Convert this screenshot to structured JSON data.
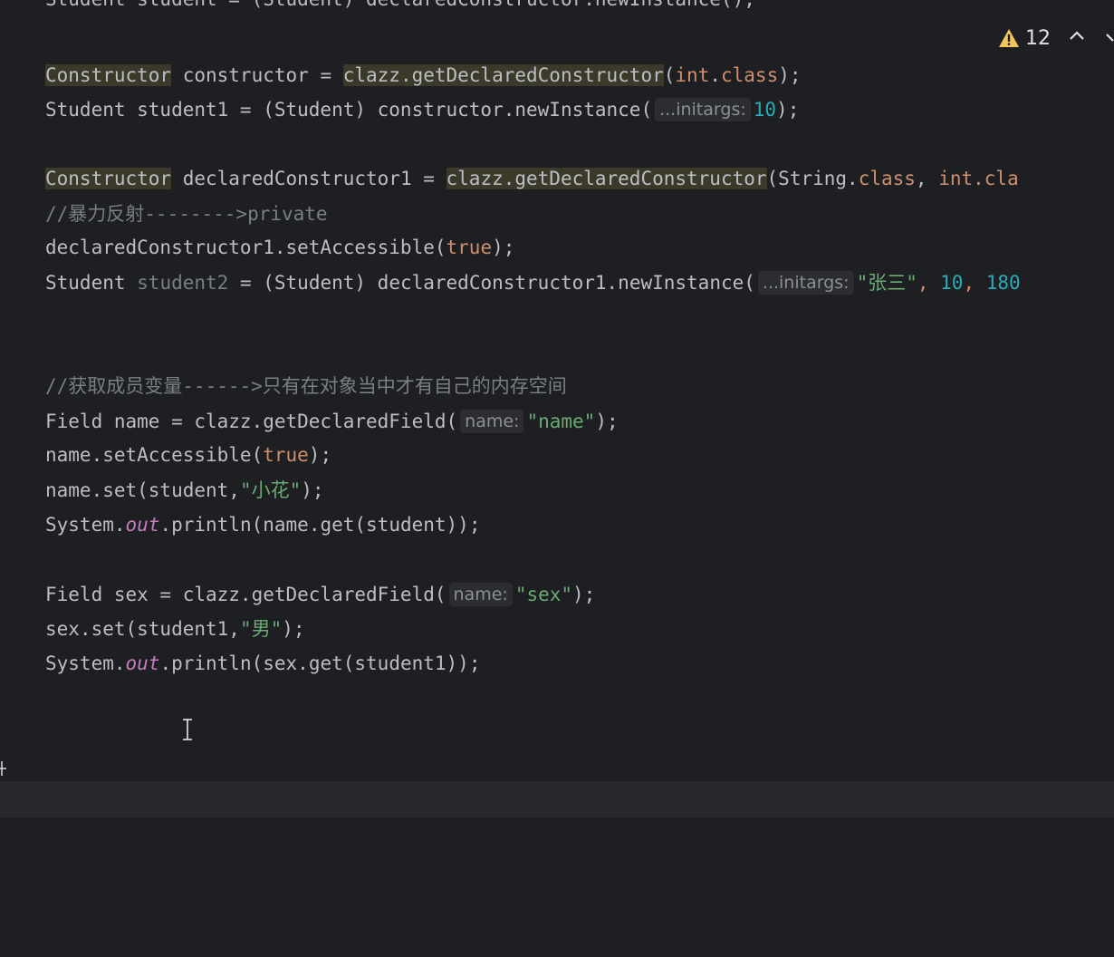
{
  "inspection": {
    "warning_count": "12",
    "warning_icon": "warning-triangle-icon",
    "up_icon": "chevron-up-icon",
    "down_icon": "chevron-down-icon"
  },
  "code": {
    "line0": "Student student = (Student) declaredConstructor.newInstance();",
    "line1": {
      "a": "Constructor",
      "b": " constructor = ",
      "c": "clazz.getDeclaredConstructor",
      "d": "(",
      "e": "int",
      "f": ".",
      "g": "class",
      "h": ");"
    },
    "line2": {
      "a": "Student student1 = (Student) constructor.newInstance(",
      "hint": "...initargs:",
      "b": "10",
      "c": ");"
    },
    "line3": {
      "a": "Constructor",
      "b": " declaredConstructor1 = ",
      "c": "clazz.getDeclaredConstructor",
      "d": "(String.",
      "e": "class",
      "f": ", ",
      "g": "int",
      "h": ".cla"
    },
    "line4": "//暴力反射-------->private",
    "line5": {
      "a": "declaredConstructor1.setAccessible(",
      "b": "true",
      "c": ");"
    },
    "line6": {
      "a": "Student ",
      "b": "student2",
      "c": " = (Student) declaredConstructor1.newInstance(",
      "hint": "...initargs:",
      "d": "\"张三\"",
      "e": ", ",
      "f": "10",
      "g": ", ",
      "h": "180"
    },
    "line7": "//获取成员变量------>只有在对象当中才有自己的内存空间",
    "line8": {
      "a": "Field name = clazz.getDeclaredField(",
      "hint": "name:",
      "b": "\"name\"",
      "c": ");"
    },
    "line9": {
      "a": "name.setAccessible(",
      "b": "true",
      "c": ");"
    },
    "line10": {
      "a": "name.set(student,",
      "b": "\"小花\"",
      "c": ");"
    },
    "line11": {
      "a": "System.",
      "b": "out",
      "c": ".println(name.get(student));"
    },
    "line12": {
      "a": "Field sex = clazz.getDeclaredField(",
      "hint": "name:",
      "b": "\"sex\"",
      "c": ");"
    },
    "line13": {
      "a": "sex.set(student1,",
      "b": "\"男\"",
      "c": ");"
    },
    "line14": {
      "a": "System.",
      "b": "out",
      "c": ".println(sex.get(student1));"
    }
  },
  "colors": {
    "background": "#1e1f22",
    "text": "#bcbec4",
    "keyword": "#cf8e6d",
    "string": "#6aab73",
    "number": "#2aacb8",
    "comment": "#7a7e85",
    "static_field": "#c77dbb",
    "warning": "#f2c55c"
  }
}
